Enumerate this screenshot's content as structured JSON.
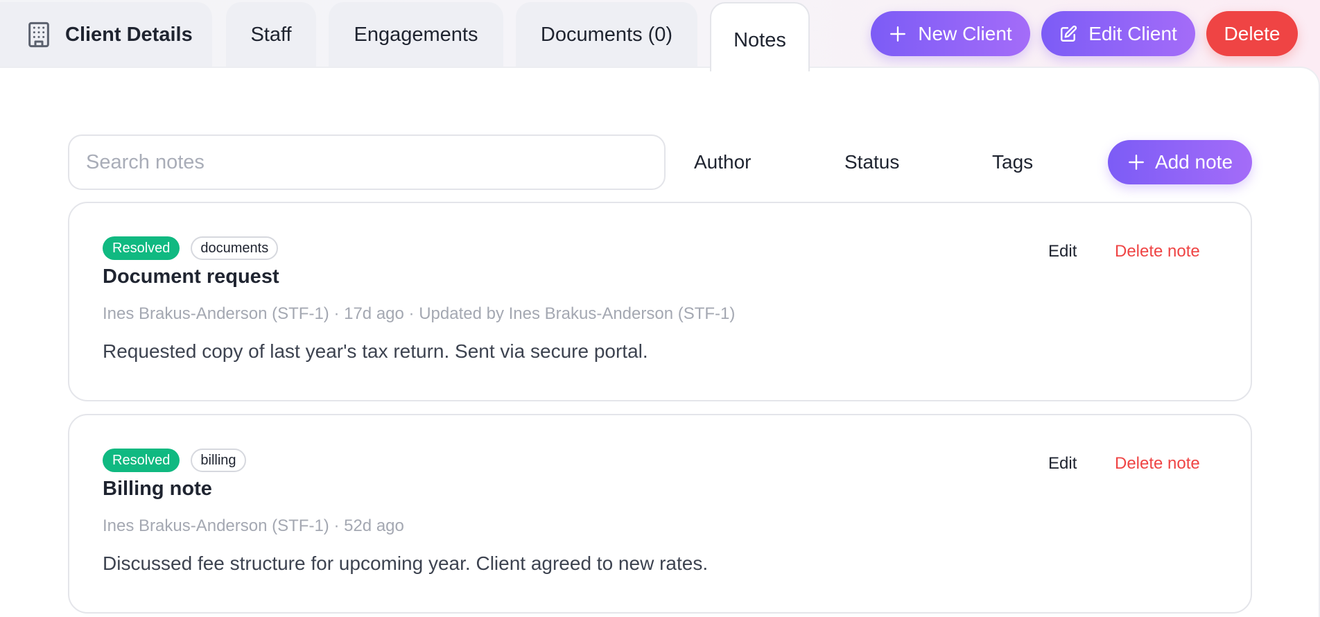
{
  "tabs": [
    {
      "label": "Client Details",
      "icon": "building-icon"
    },
    {
      "label": "Staff"
    },
    {
      "label": "Engagements"
    },
    {
      "label": "Documents (0)"
    },
    {
      "label": "Notes",
      "active": true
    }
  ],
  "actions": {
    "new_client": "New Client",
    "edit_client": "Edit Client",
    "delete": "Delete"
  },
  "notes_toolbar": {
    "search_placeholder": "Search notes",
    "filters": [
      "Author",
      "Status",
      "Tags"
    ],
    "add_note": "Add note"
  },
  "notes": [
    {
      "status": "Resolved",
      "tag": "documents",
      "title": "Document request",
      "meta": "Ines Brakus-Anderson (STF-1) · 17d ago · Updated by Ines Brakus-Anderson (STF-1)",
      "body": "Requested copy of last year's tax return. Sent via secure portal.",
      "edit_label": "Edit",
      "delete_label": "Delete note"
    },
    {
      "status": "Resolved",
      "tag": "billing",
      "title": "Billing note",
      "meta": "Ines Brakus-Anderson (STF-1) · 52d ago",
      "body": "Discussed fee structure for upcoming year. Client agreed to new rates.",
      "edit_label": "Edit",
      "delete_label": "Delete note"
    }
  ],
  "colors": {
    "accent_start": "#7c5cf6",
    "accent_end": "#a46cf8",
    "danger": "#ef4444",
    "resolved": "#10b981"
  }
}
